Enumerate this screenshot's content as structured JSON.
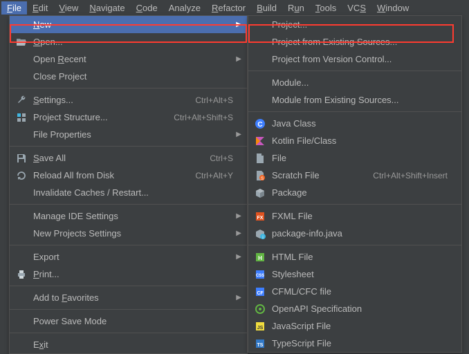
{
  "menubar": {
    "items": [
      {
        "label": "File",
        "mnemonic": "F"
      },
      {
        "label": "Edit",
        "mnemonic": "E"
      },
      {
        "label": "View",
        "mnemonic": "V"
      },
      {
        "label": "Navigate",
        "mnemonic": "N"
      },
      {
        "label": "Code",
        "mnemonic": "C"
      },
      {
        "label": "Analyze",
        "mnemonic": null
      },
      {
        "label": "Refactor",
        "mnemonic": "R"
      },
      {
        "label": "Build",
        "mnemonic": "B"
      },
      {
        "label": "Run",
        "mnemonic": "u"
      },
      {
        "label": "Tools",
        "mnemonic": "T"
      },
      {
        "label": "VCS",
        "mnemonic": "S"
      },
      {
        "label": "Window",
        "mnemonic": "W"
      }
    ]
  },
  "fileMenu": {
    "items": [
      {
        "label": "New",
        "mnemonic": "N",
        "icon": null,
        "shortcut": null,
        "submenu": true,
        "highlighted": true
      },
      {
        "label": "Open...",
        "mnemonic": "O",
        "icon": "folder-open",
        "shortcut": null,
        "submenu": false
      },
      {
        "label": "Open Recent",
        "mnemonic": "R",
        "icon": null,
        "shortcut": null,
        "submenu": true
      },
      {
        "label": "Close Project",
        "mnemonic": null,
        "icon": null,
        "shortcut": null,
        "submenu": false
      },
      {
        "sep": true
      },
      {
        "label": "Settings...",
        "mnemonic": "S",
        "icon": "wrench",
        "shortcut": "Ctrl+Alt+S",
        "submenu": false
      },
      {
        "label": "Project Structure...",
        "mnemonic": null,
        "icon": "project-structure",
        "shortcut": "Ctrl+Alt+Shift+S",
        "submenu": false
      },
      {
        "label": "File Properties",
        "mnemonic": null,
        "icon": null,
        "shortcut": null,
        "submenu": true
      },
      {
        "sep": true
      },
      {
        "label": "Save All",
        "mnemonic": "S",
        "icon": "save",
        "shortcut": "Ctrl+S",
        "submenu": false
      },
      {
        "label": "Reload All from Disk",
        "mnemonic": null,
        "icon": "reload",
        "shortcut": "Ctrl+Alt+Y",
        "submenu": false
      },
      {
        "label": "Invalidate Caches / Restart...",
        "mnemonic": null,
        "icon": null,
        "shortcut": null,
        "submenu": false
      },
      {
        "sep": true
      },
      {
        "label": "Manage IDE Settings",
        "mnemonic": null,
        "icon": null,
        "shortcut": null,
        "submenu": true
      },
      {
        "label": "New Projects Settings",
        "mnemonic": null,
        "icon": null,
        "shortcut": null,
        "submenu": true
      },
      {
        "sep": true
      },
      {
        "label": "Export",
        "mnemonic": null,
        "icon": null,
        "shortcut": null,
        "submenu": true
      },
      {
        "label": "Print...",
        "mnemonic": "P",
        "icon": "print",
        "shortcut": null,
        "submenu": false
      },
      {
        "sep": true
      },
      {
        "label": "Add to Favorites",
        "mnemonic": "F",
        "icon": null,
        "shortcut": null,
        "submenu": true
      },
      {
        "sep": true
      },
      {
        "label": "Power Save Mode",
        "mnemonic": null,
        "icon": null,
        "shortcut": null,
        "submenu": false
      },
      {
        "sep": true
      },
      {
        "label": "Exit",
        "mnemonic": "x",
        "icon": null,
        "shortcut": null,
        "submenu": false
      }
    ]
  },
  "newMenu": {
    "items": [
      {
        "label": "Project...",
        "icon": null,
        "shortcut": null
      },
      {
        "label": "Project from Existing Sources...",
        "icon": null,
        "shortcut": null
      },
      {
        "label": "Project from Version Control...",
        "icon": null,
        "shortcut": null
      },
      {
        "sep": true
      },
      {
        "label": "Module...",
        "icon": null,
        "shortcut": null
      },
      {
        "label": "Module from Existing Sources...",
        "icon": null,
        "shortcut": null
      },
      {
        "sep": true
      },
      {
        "label": "Java Class",
        "icon": "java-class",
        "shortcut": null
      },
      {
        "label": "Kotlin File/Class",
        "icon": "kotlin",
        "shortcut": null
      },
      {
        "label": "File",
        "icon": "file",
        "shortcut": null
      },
      {
        "label": "Scratch File",
        "icon": "scratch",
        "shortcut": "Ctrl+Alt+Shift+Insert"
      },
      {
        "label": "Package",
        "icon": "package",
        "shortcut": null
      },
      {
        "sep": true
      },
      {
        "label": "FXML File",
        "icon": "fxml",
        "shortcut": null
      },
      {
        "label": "package-info.java",
        "icon": "package-info",
        "shortcut": null
      },
      {
        "sep": true
      },
      {
        "label": "HTML File",
        "icon": "html",
        "shortcut": null
      },
      {
        "label": "Stylesheet",
        "icon": "css",
        "shortcut": null
      },
      {
        "label": "CFML/CFC file",
        "icon": "cfml",
        "shortcut": null
      },
      {
        "label": "OpenAPI Specification",
        "icon": "openapi",
        "shortcut": null
      },
      {
        "label": "JavaScript File",
        "icon": "js",
        "shortcut": null
      },
      {
        "label": "TypeScript File",
        "icon": "ts",
        "shortcut": null
      }
    ]
  }
}
